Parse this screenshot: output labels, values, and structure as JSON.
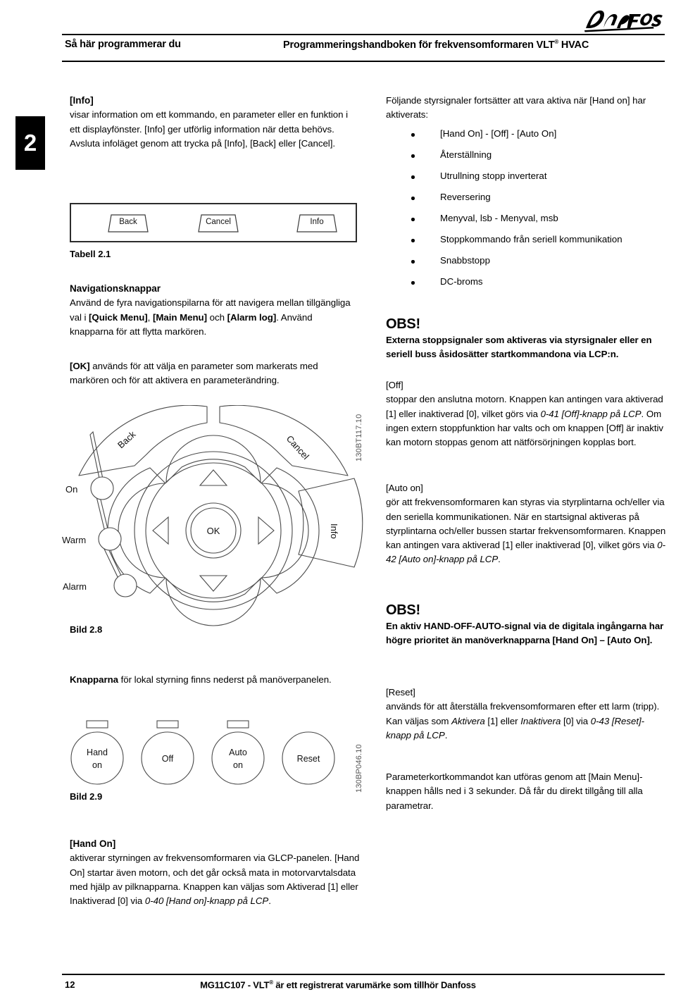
{
  "header": {
    "left_title": "Så här programmerar du",
    "center_title_main": "Programmeringshandboken för frekvensomformaren VLT",
    "center_title_sup": "®",
    "center_title_tail": " HVAC",
    "logo_name": "Danfoss"
  },
  "chapter_tab": {
    "number": "2"
  },
  "left_column": {
    "info_heading": "[Info]",
    "info_paragraph": "visar information om ett kommando, en parameter eller en funktion i ett displayfönster. [Info] ger utförlig information när detta behövs.",
    "info_paragraph2": "Avsluta infoläget genom att trycka på [Info], [Back] eller [Cancel].",
    "keycaps": [
      {
        "label": "Back"
      },
      {
        "label": "Cancel"
      },
      {
        "label": "Info"
      }
    ],
    "table_caption": "Tabell 2.1",
    "nav_heading": "Navigationsknappar",
    "nav_paragraph_a": "Använd de fyra navigationspilarna för att navigera mellan tillgängliga val i ",
    "nav_quick_menu": "[Quick Menu]",
    "nav_comma": ", ",
    "nav_main_menu": "[Main Menu]",
    "nav_och": " och ",
    "nav_alarm_log": "[Alarm log]",
    "nav_paragraph_b": ". Använd knapparna för att flytta markören.",
    "ok_bold": "[OK]",
    "ok_rest": " används för att välja en parameter som markerats med markören och för att aktivera en parameterändring.",
    "wheel": {
      "back_label": "Back",
      "cancel_label": "Cancel",
      "info_label": "Info",
      "ok_label": "OK",
      "led_on": "On",
      "led_warm": "Warm",
      "led_alarm": "Alarm",
      "figure_id": "130BT117.10",
      "caption": "Bild 2.8"
    },
    "knapparna_bold": "Knapparna",
    "knapparna_rest": " för lokal styrning finns nederst på manöverpanelen.",
    "local_keys": {
      "keys": [
        {
          "line1": "Hand",
          "line2": "on",
          "has_led": true
        },
        {
          "line1": "Off",
          "line2": "",
          "has_led": true
        },
        {
          "line1": "Auto",
          "line2": "on",
          "has_led": true
        },
        {
          "line1": "Reset",
          "line2": "",
          "has_led": false
        }
      ],
      "figure_id": "130BP046.10",
      "caption": "Bild 2.9"
    },
    "hand_on_heading": "[Hand On]",
    "hand_on_para_a": "aktiverar styrningen av frekvensomformaren via GLCP-panelen. [Hand On] startar även motorn, och det går också mata in motorvarvtalsdata med hjälp av pilknapparna. Knappen kan väljas som Aktiverad [1] eller Inaktiverad [0] via ",
    "hand_on_param": "0-40 [Hand on]-knapp på LCP",
    "hand_on_para_b": "."
  },
  "right_column": {
    "intro": "Följande styrsignaler fortsätter att vara aktiva när [Hand on] har aktiverats:",
    "bullets": [
      "[Hand On] - [Off] - [Auto On]",
      "Återställning",
      "Utrullning stopp inverterat",
      "Reversering",
      "Menyval, lsb - Menyval, msb",
      "Stoppkommando från seriell kommunikation",
      "Snabbstopp",
      "DC-broms"
    ],
    "obs1_title": "OBS!",
    "obs1_body": "Externa stoppsignaler som aktiveras via styrsignaler eller en seriell buss åsidosätter startkommandona via LCP:n.",
    "off_heading": "[Off]",
    "off_para_a": "stoppar den anslutna motorn. Knappen kan antingen vara aktiverad [1] eller inaktiverad [0], vilket görs via ",
    "off_param": "0-41 [Off]-knapp på LCP",
    "off_para_b": ". Om ingen extern stoppfunktion har valts och om knappen [Off] är inaktiv kan motorn stoppas genom att nätförsörjningen kopplas bort.",
    "auto_heading": "[Auto on]",
    "auto_para_a": "gör att frekvensomformaren kan styras via styrplintarna och/eller via den seriella kommunikationen. När en startsignal aktiveras på styrplintarna och/eller bussen startar frekvensomformaren. Knappen kan antingen vara aktiverad [1] eller inaktiverad [0], vilket görs via ",
    "auto_param": "0-42 [Auto on]-knapp på LCP",
    "auto_para_b": ".",
    "obs2_title": "OBS!",
    "obs2_body": "En aktiv HAND-OFF-AUTO-signal via de digitala ingångarna har högre prioritet än manöverknapparna [Hand On] – [Auto On].",
    "reset_heading": "[Reset]",
    "reset_para_a": "används för att återställa frekvensomformaren efter ett larm (tripp). Kan väljas som ",
    "reset_aktivera": "Aktivera",
    "reset_mid1": " [1] eller ",
    "reset_inaktivera": "Inaktivera",
    "reset_mid2": " [0] via ",
    "reset_param": "0-43 [Reset]-knapp på LCP",
    "reset_para_b": ".",
    "param_shortcut": "Parameterkortkommandot kan utföras genom att [Main Menu]-knappen hålls ned i 3 sekunder. Då får du direkt tillgång till alla parametrar."
  },
  "footer": {
    "page_number": "12",
    "center_main": "MG11C107 - VLT",
    "center_sup": "®",
    "center_tail": " är ett registrerat varumärke som tillhör Danfoss"
  }
}
